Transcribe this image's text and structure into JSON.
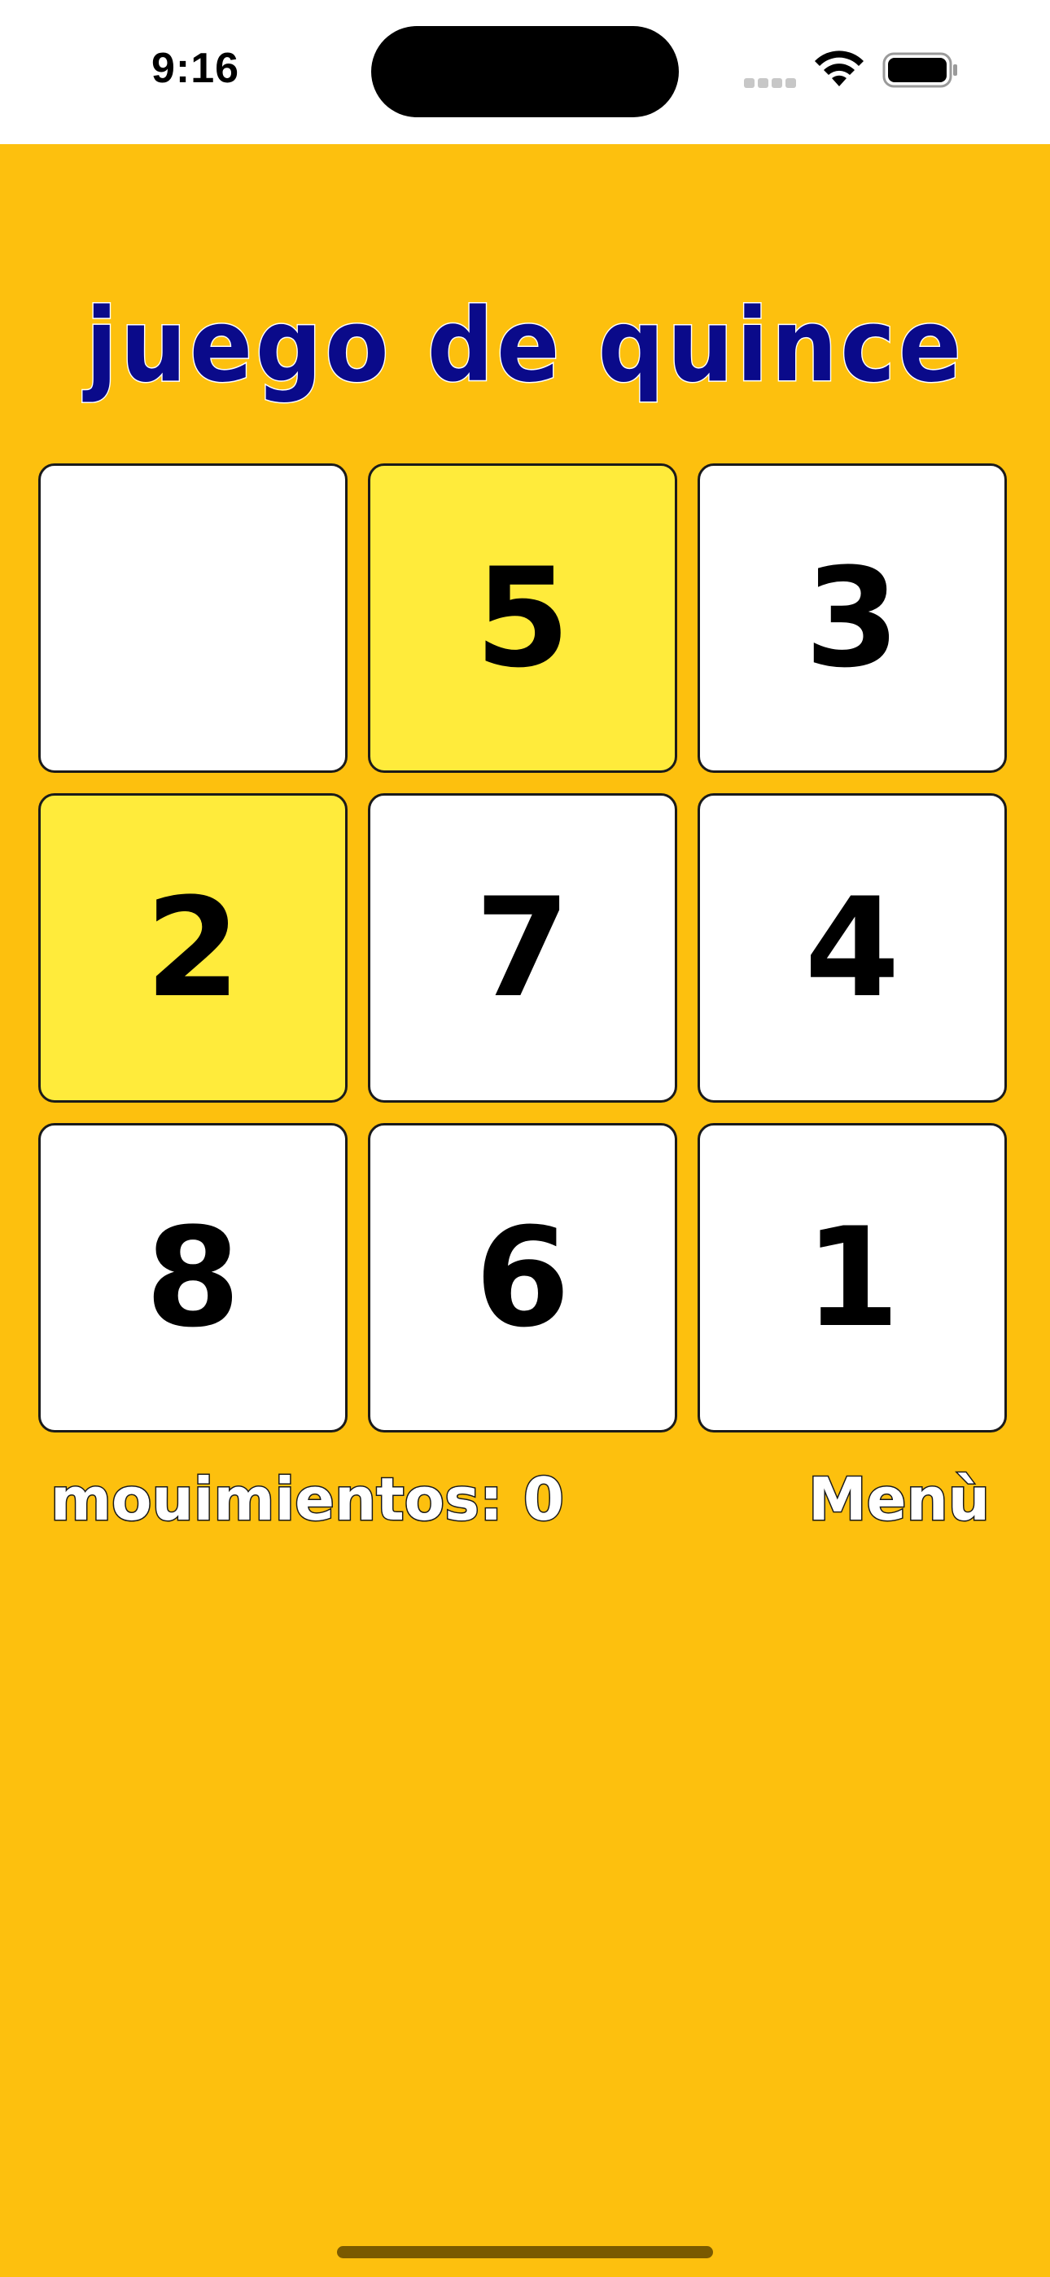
{
  "status": {
    "time": "9:16"
  },
  "title": "juego de quince",
  "board": {
    "tiles": [
      {
        "label": "",
        "highlight": false
      },
      {
        "label": "5",
        "highlight": true
      },
      {
        "label": "3",
        "highlight": false
      },
      {
        "label": "2",
        "highlight": true
      },
      {
        "label": "7",
        "highlight": false
      },
      {
        "label": "4",
        "highlight": false
      },
      {
        "label": "8",
        "highlight": false
      },
      {
        "label": "6",
        "highlight": false
      },
      {
        "label": "1",
        "highlight": false
      }
    ]
  },
  "footer": {
    "moves_text": "mouimientos: 0",
    "menu_label": "Menù"
  },
  "colors": {
    "background": "#FDC00E",
    "highlight_tile": "#FFEB3B",
    "title": "#0A0A8A"
  },
  "icons": {
    "signal": "cellular-signal-icon",
    "wifi": "wifi-icon",
    "battery": "battery-icon"
  }
}
